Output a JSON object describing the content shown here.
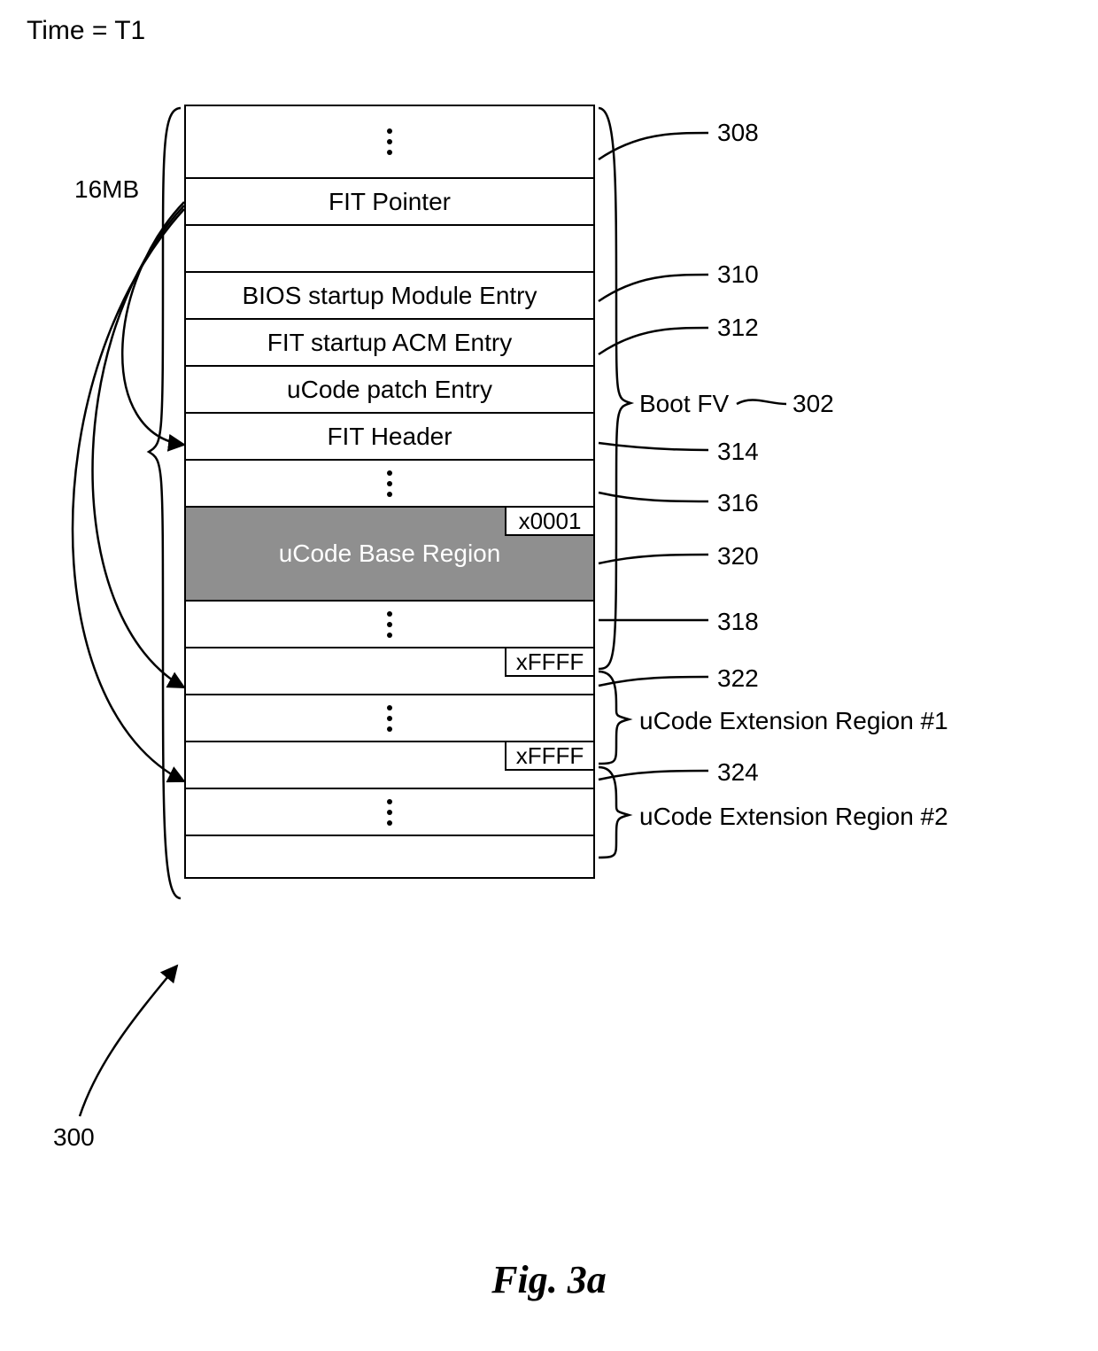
{
  "meta": {
    "time_label": "Time = T1"
  },
  "left": {
    "size_label": "16MB"
  },
  "rows": {
    "fit_pointer": "FIT Pointer",
    "bios_startup": "BIOS startup Module Entry",
    "fit_acm": "FIT startup ACM Entry",
    "ucode_patch": "uCode patch Entry",
    "fit_header": "FIT Header",
    "base_region": "uCode Base Region",
    "base_region_tag": "x0001",
    "ext1_tag": "xFFFF",
    "ext2_tag": "xFFFF"
  },
  "right": {
    "boot_fv": "Boot FV",
    "boot_fv_ref": "302",
    "ext1": "uCode Extension Region #1",
    "ext2": "uCode Extension Region #2"
  },
  "refs": {
    "r300": "300",
    "r308": "308",
    "r310": "310",
    "r312": "312",
    "r314": "314",
    "r316": "316",
    "r318": "318",
    "r320": "320",
    "r322": "322",
    "r324": "324"
  },
  "caption": "Fig. 3a"
}
